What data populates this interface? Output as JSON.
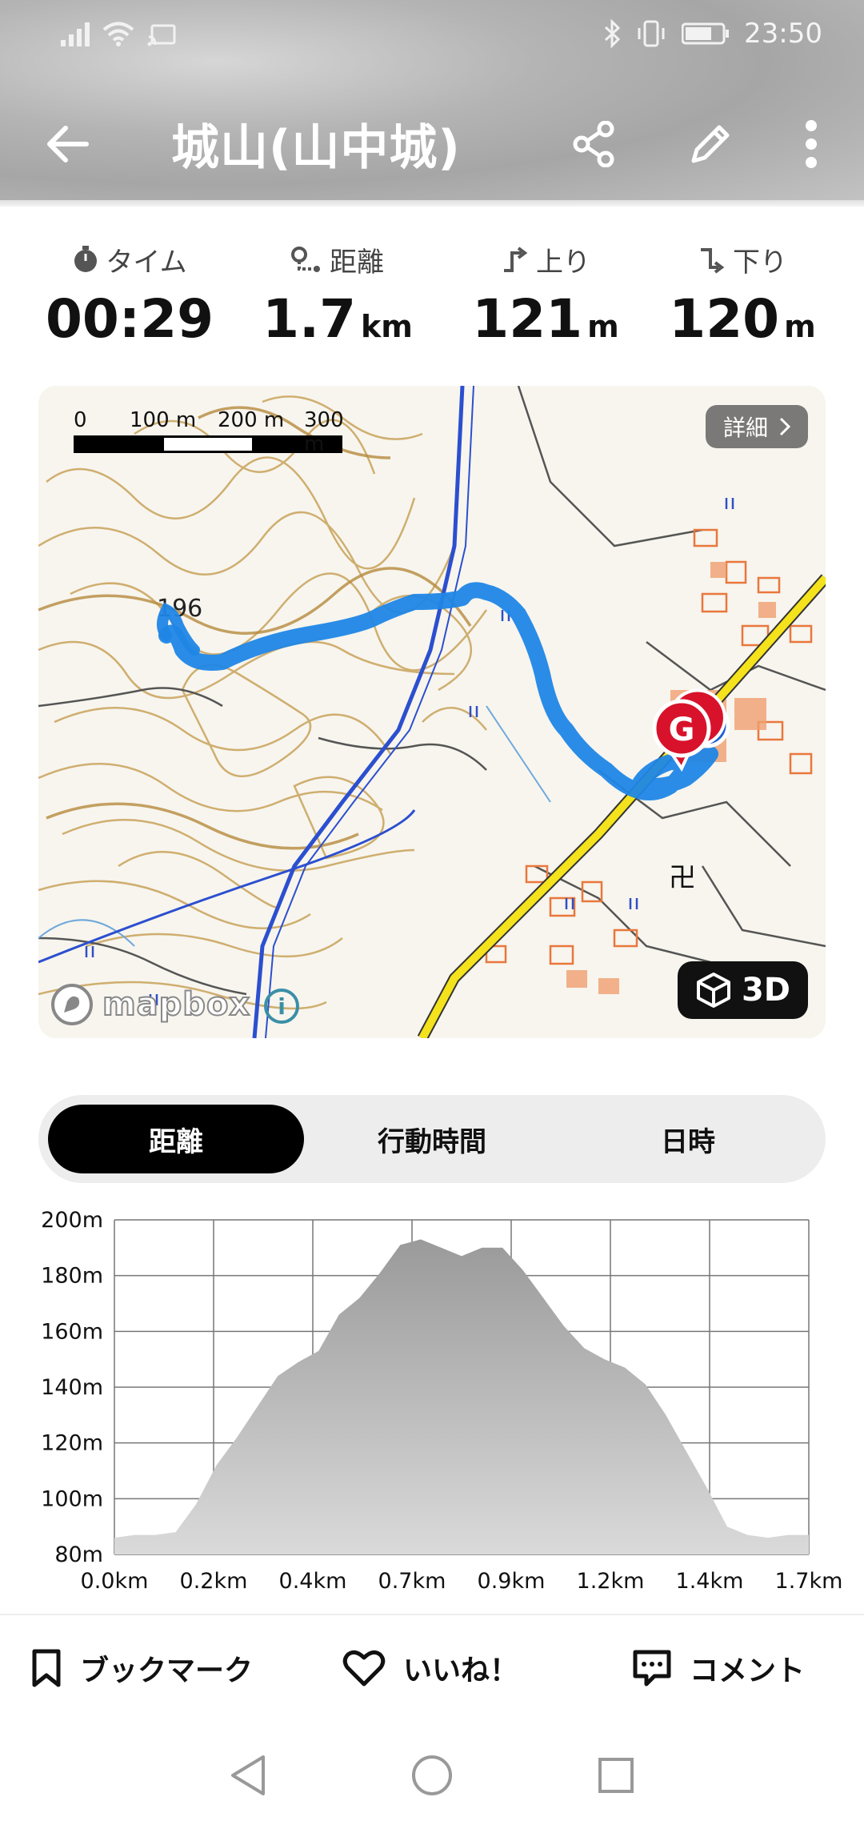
{
  "status_bar": {
    "time": "23:50"
  },
  "header": {
    "title": "城山(山中城)"
  },
  "stats": [
    {
      "label": "タイム",
      "value": "00:29",
      "unit": "",
      "icon": "stopwatch-icon"
    },
    {
      "label": "距離",
      "value": "1.7",
      "unit": "km",
      "icon": "route-icon"
    },
    {
      "label": "上り",
      "value": "121",
      "unit": "m",
      "icon": "ascent-icon"
    },
    {
      "label": "下り",
      "value": "120",
      "unit": "m",
      "icon": "descent-icon"
    }
  ],
  "map": {
    "scale_labels": [
      "0",
      "100 m",
      "200 m",
      "300 m"
    ],
    "detail_label": "詳細",
    "elevation_label": "196",
    "goal_marker": "G",
    "mapbox_label": "mapbox",
    "btn_3d_label": "3D"
  },
  "segment": {
    "tabs": [
      "距離",
      "行動時間",
      "日時"
    ],
    "active": 0
  },
  "chart_data": {
    "type": "area",
    "xlabel": "",
    "ylabel": "",
    "x_tick_labels": [
      "0.0km",
      "0.2km",
      "0.4km",
      "0.7km",
      "0.9km",
      "1.2km",
      "1.4km",
      "1.7km"
    ],
    "y_tick_labels": [
      "80m",
      "100m",
      "120m",
      "140m",
      "160m",
      "180m",
      "200m"
    ],
    "ylim": [
      80,
      200
    ],
    "xlim": [
      0,
      1.7
    ],
    "x": [
      0,
      0.05,
      0.1,
      0.15,
      0.2,
      0.25,
      0.3,
      0.35,
      0.4,
      0.45,
      0.5,
      0.55,
      0.6,
      0.65,
      0.7,
      0.75,
      0.8,
      0.85,
      0.9,
      0.95,
      1.0,
      1.05,
      1.1,
      1.15,
      1.2,
      1.25,
      1.3,
      1.35,
      1.4,
      1.45,
      1.5,
      1.55,
      1.6,
      1.65,
      1.7
    ],
    "values": [
      86,
      87,
      87,
      88,
      98,
      112,
      122,
      133,
      144,
      149,
      153,
      166,
      172,
      181,
      191,
      193,
      190,
      187,
      190,
      190,
      182,
      172,
      162,
      154,
      150,
      147,
      141,
      130,
      117,
      104,
      90,
      87,
      86,
      87,
      87
    ],
    "grid": true,
    "fill_color": "#a8a8a8"
  },
  "bottom_actions": {
    "bookmark": "ブックマーク",
    "like": "いいね！",
    "comment": "コメント"
  }
}
